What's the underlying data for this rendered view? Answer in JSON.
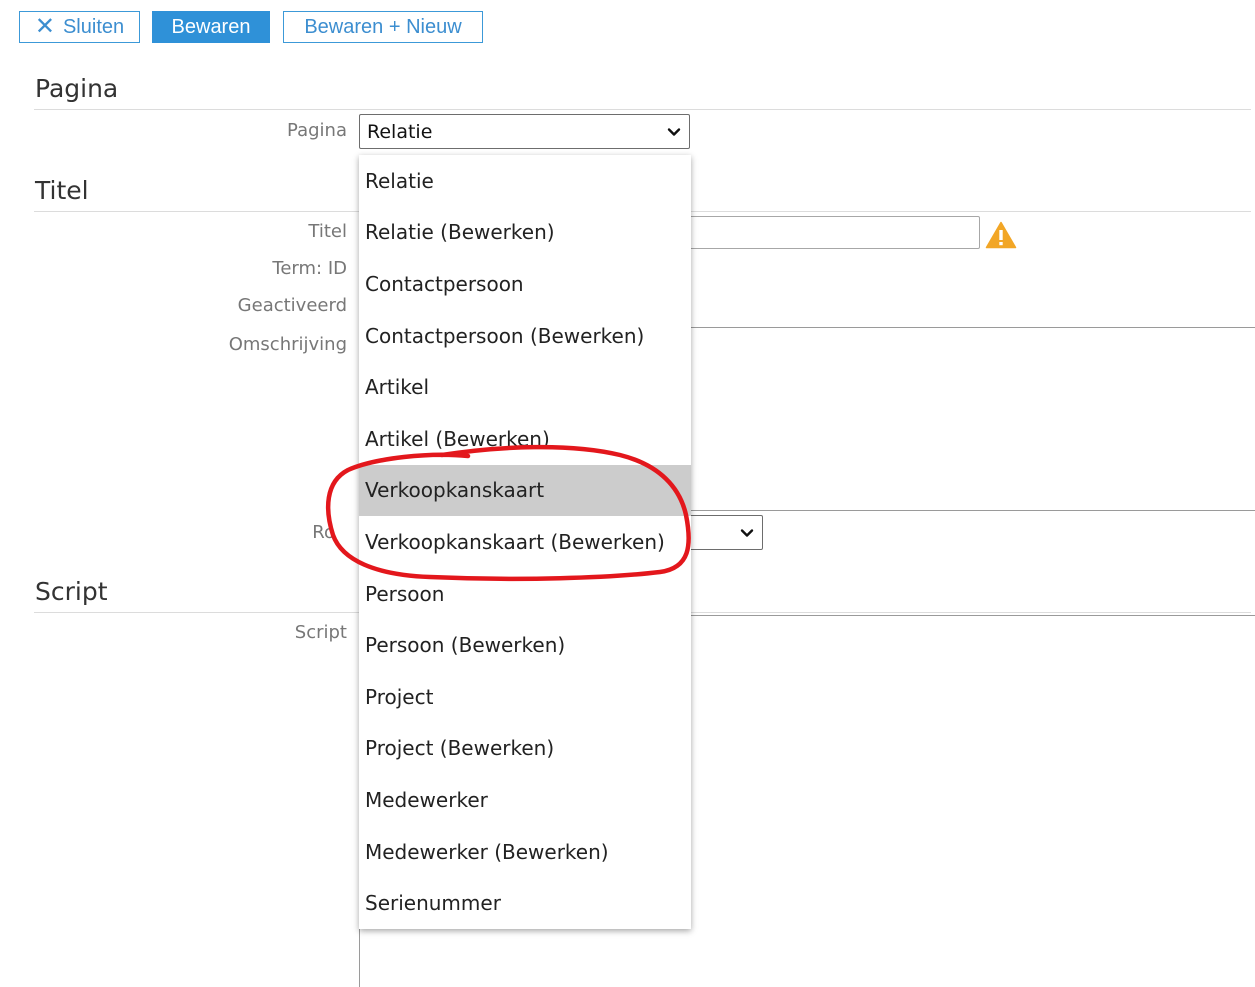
{
  "toolbar": {
    "close_label": "Sluiten",
    "save_label": "Bewaren",
    "save_new_label": "Bewaren + Nieuw"
  },
  "sections": {
    "pagina": {
      "title": "Pagina",
      "field_label": "Pagina",
      "selected_value": "Relatie"
    },
    "titel": {
      "title": "Titel",
      "labels": [
        "Titel",
        "Term: ID",
        "Geactiveerd",
        "Omschrijving"
      ],
      "rol_label_partial": "Ro"
    },
    "script": {
      "title": "Script",
      "field_label": "Script"
    }
  },
  "dropdown": {
    "options": [
      "Relatie",
      "Relatie (Bewerken)",
      "Contactpersoon",
      "Contactpersoon (Bewerken)",
      "Artikel",
      "Artikel (Bewerken)",
      "Verkoopkanskaart",
      "Verkoopkanskaart (Bewerken)",
      "Persoon",
      "Persoon (Bewerken)",
      "Project",
      "Project (Bewerken)",
      "Medewerker",
      "Medewerker (Bewerken)",
      "Serienummer"
    ],
    "highlighted_index": 6
  },
  "colors": {
    "accent": "#2f91d8",
    "warning": "#f2a626",
    "annotation": "#e3171c"
  },
  "icons": {
    "close": "close-icon",
    "warning": "warning-icon",
    "chevron": "chevron-down-icon"
  }
}
